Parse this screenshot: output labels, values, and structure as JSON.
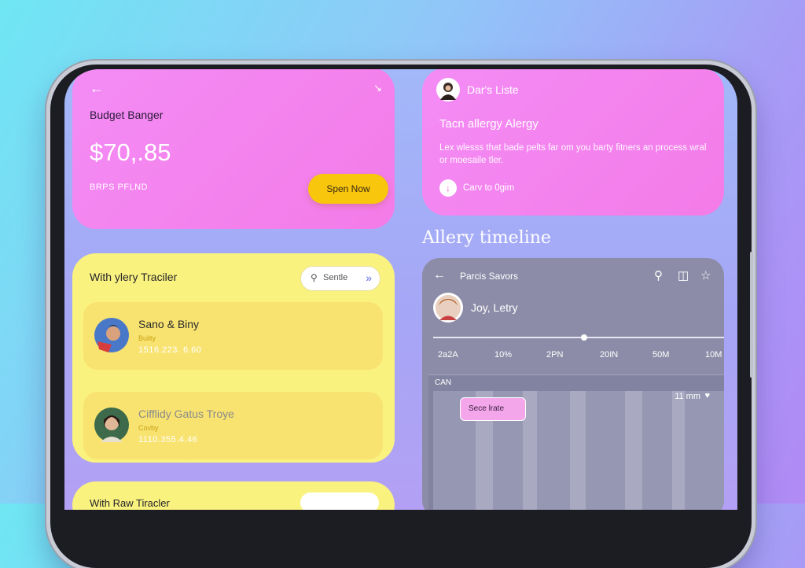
{
  "budget": {
    "title": "Budget Banger",
    "amount": "$70,.85",
    "sub": "BRPS PFLND",
    "cta": "Spen Now",
    "back_icon": "arrow-left-icon",
    "chevron_icon": "chevron-down-icon"
  },
  "allergy_card": {
    "name": "Dar's Liste",
    "heading": "Tacn allergy Alergy",
    "body": "Lex wlesss that bade pelts far om you barty fitners an process wral or moesaile tler.",
    "link": "Carv to 0gim"
  },
  "section_title": "Allery timeline",
  "tracker": {
    "title": "With ylery Traciler",
    "settle_label": "Sentle",
    "entries": [
      {
        "name": "Sano & Biny",
        "tag": "Builty",
        "amount": "1516.223. 6.60"
      },
      {
        "name": "Cifflidy Gatus Troye",
        "tag": "Covby",
        "amount": "1110.355.4.46"
      }
    ]
  },
  "tracker2": {
    "title": "With Raw Tiracler"
  },
  "timeline": {
    "title": "Parcis Savors",
    "user": "Joy, Letry",
    "ticks": [
      "2a2A",
      "10%",
      "2PN",
      "20IN",
      "50M",
      "10M"
    ],
    "progress_pct": 52,
    "grid_label": "CAN",
    "bubble": "Sece lrate",
    "um": "11 mm",
    "um2": "♥"
  },
  "colors": {
    "accent_pink": "#f37be8",
    "accent_yellow": "#faf27f",
    "cta": "#f8c60d"
  }
}
